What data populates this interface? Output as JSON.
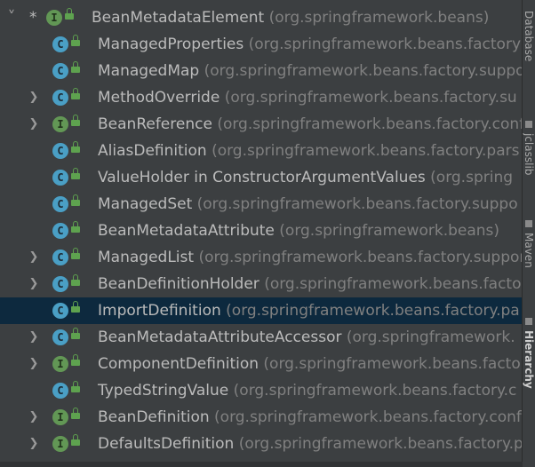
{
  "tree": {
    "rows": [
      {
        "expanded": true,
        "star": "*",
        "icon": "interface-icon",
        "icon_letter": "I",
        "name": "BeanMetadataElement",
        "pkg": "(org.springframework.beans)"
      },
      {
        "icon": "class-icon",
        "icon_letter": "C",
        "name": "ManagedProperties",
        "pkg": "(org.springframework.beans.factory"
      },
      {
        "icon": "class-icon",
        "icon_letter": "C",
        "name": "ManagedMap",
        "pkg": "(org.springframework.beans.factory.suppo"
      },
      {
        "has_children": true,
        "icon": "class-icon",
        "icon_letter": "C",
        "name": "MethodOverride",
        "pkg": "(org.springframework.beans.factory.su"
      },
      {
        "has_children": true,
        "icon": "interface-icon",
        "icon_letter": "I",
        "name": "BeanReference",
        "pkg": "(org.springframework.beans.factory.conf"
      },
      {
        "icon": "class-icon",
        "icon_letter": "C",
        "name": "AliasDefinition",
        "pkg": "(org.springframework.beans.factory.pars"
      },
      {
        "icon": "class-icon",
        "icon_letter": "C",
        "name": "ValueHolder in ConstructorArgumentValues",
        "pkg": "(org.spring"
      },
      {
        "icon": "class-icon",
        "icon_letter": "C",
        "name": "ManagedSet",
        "pkg": "(org.springframework.beans.factory.suppo"
      },
      {
        "icon": "class-icon",
        "icon_letter": "C",
        "name": "BeanMetadataAttribute",
        "pkg": "(org.springframework.beans)"
      },
      {
        "has_children": true,
        "icon": "class-icon",
        "icon_letter": "C",
        "name": "ManagedList",
        "pkg": "(org.springframework.beans.factory.suppor"
      },
      {
        "has_children": true,
        "icon": "class-icon",
        "icon_letter": "C",
        "name": "BeanDefinitionHolder",
        "pkg": "(org.springframework.beans.facto"
      },
      {
        "selected": true,
        "icon": "class-icon",
        "icon_letter": "C",
        "name": "ImportDefinition",
        "pkg": "(org.springframework.beans.factory.pa"
      },
      {
        "has_children": true,
        "icon": "class-icon",
        "icon_letter": "C",
        "name": "BeanMetadataAttributeAccessor",
        "pkg": "(org.springframework."
      },
      {
        "has_children": true,
        "icon": "interface-icon",
        "icon_letter": "I",
        "name": "ComponentDefinition",
        "pkg": "(org.springframework.beans.facto"
      },
      {
        "icon": "class-icon",
        "icon_letter": "C",
        "name": "TypedStringValue",
        "pkg": "(org.springframework.beans.factory.c"
      },
      {
        "has_children": true,
        "icon": "interface-icon",
        "icon_letter": "I",
        "name": "BeanDefinition",
        "pkg": "(org.springframework.beans.factory.conf"
      },
      {
        "has_children": true,
        "icon": "interface-icon",
        "icon_letter": "I",
        "name": "DefaultsDefinition",
        "pkg": "(org.springframework.beans.factory.p"
      }
    ]
  },
  "sidebar": {
    "tabs": [
      {
        "label": "Database"
      },
      {
        "label": "jclasslib"
      },
      {
        "label": "Maven"
      },
      {
        "label": "Hierarchy"
      }
    ]
  },
  "colors": {
    "background": "#3c3f41",
    "selection": "#0d293e",
    "class_icon": "#4a9fc5",
    "interface_icon": "#629755",
    "package_text": "#808080"
  }
}
